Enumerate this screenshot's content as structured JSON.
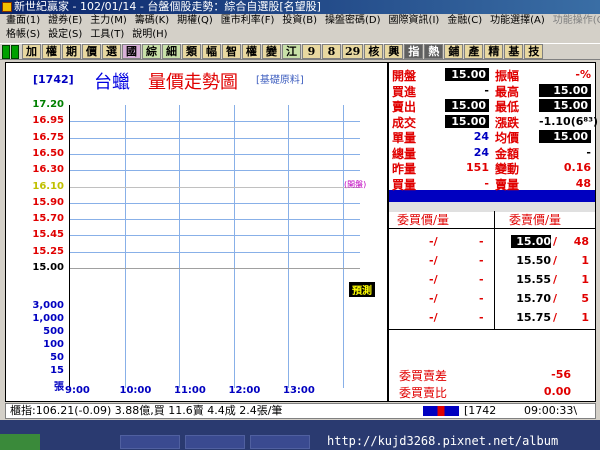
{
  "window": {
    "title": "新世紀贏家 - 102/01/14 - 台盤個股走勢：綜合自選股[名望股]"
  },
  "menu": {
    "row1": [
      "畫面(1)",
      "證券(E)",
      "主力(M)",
      "籌碼(K)",
      "期權(Q)",
      "匯市利率(F)",
      "投資(B)",
      "操盤密碼(D)",
      "國際資訊(I)",
      "金融(C)",
      "功能選擇(A)",
      "功能操作(O)"
    ],
    "row2": [
      "格帳(S)",
      "設定(S)",
      "工具(T)",
      "說明(H)"
    ]
  },
  "toolbar": {
    "buttons": [
      "加",
      "權",
      "期",
      "價",
      "選",
      "國",
      "綜",
      "細",
      "類",
      "幅",
      "智",
      "權",
      "變",
      "江",
      "9",
      "8",
      "29",
      "核",
      "興",
      "指",
      "熱",
      "鋪",
      "產",
      "精",
      "基",
      "技"
    ]
  },
  "chart": {
    "code": "[1742]",
    "stock_name": "台蠟",
    "title": "量價走勢圖",
    "category": "[基礎原料]",
    "ref_note": "(開盤)",
    "open_label": "預測"
  },
  "chart_data": {
    "type": "line",
    "title": "量價走勢圖",
    "price_ticks": [
      "17.20",
      "16.95",
      "16.75",
      "16.50",
      "16.30",
      "16.10",
      "15.90",
      "15.70",
      "15.45",
      "15.25",
      "15.00"
    ],
    "volume_ticks": [
      "3,000",
      "1,000",
      "500",
      "100",
      "50",
      "15",
      "張"
    ],
    "x_ticks": [
      "9:00",
      "10:00",
      "11:00",
      "12:00",
      "13:00"
    ],
    "reference_price": 16.1,
    "ylim": [
      15.0,
      17.2
    ],
    "series": []
  },
  "quote": {
    "rows": [
      {
        "l1": "開盤",
        "v1": "15.00",
        "l2": "振幅",
        "v2": "-%"
      },
      {
        "l1": "買進",
        "v1": "-",
        "l2": "最高",
        "v2": "15.00"
      },
      {
        "l1": "賣出",
        "v1": "15.00",
        "l2": "最低",
        "v2": "15.00"
      },
      {
        "l1": "成交",
        "v1": "15.00",
        "l2": "漲跌",
        "v2": "-1.10(6⁸³)"
      },
      {
        "l1": "單量",
        "v1": "24",
        "l2": "均價",
        "v2": "15.00"
      },
      {
        "l1": "總量",
        "v1": "24",
        "l2": "金額",
        "v2": "-"
      },
      {
        "l1": "昨量",
        "v1": "151",
        "l2": "變動",
        "v2": "0.16"
      },
      {
        "l1": "買量",
        "v1": "-",
        "l2": "賣量",
        "v2": "48"
      }
    ],
    "bid_header": "委買價/量",
    "ask_header": "委賣價/量",
    "bids": [
      {
        "p": "-/",
        "v": "-"
      },
      {
        "p": "-/",
        "v": "-"
      },
      {
        "p": "-/",
        "v": "-"
      },
      {
        "p": "-/",
        "v": "-"
      },
      {
        "p": "-/",
        "v": "-"
      }
    ],
    "asks": [
      {
        "p": "15.00",
        "v": "48"
      },
      {
        "p": "15.50",
        "v": "1"
      },
      {
        "p": "15.55",
        "v": "1"
      },
      {
        "p": "15.70",
        "v": "5"
      },
      {
        "p": "15.75",
        "v": "1"
      }
    ],
    "spread_label": "委買賣差",
    "spread": "-56",
    "ratio_label": "委買賣比",
    "ratio": "0.00"
  },
  "status": {
    "text": "櫃指:106.21(-0.09) 3.88億,買 11.6賣 4.4成 2.4張/筆",
    "code": "[1742",
    "time": "09:00:33\\"
  },
  "taskbar": {
    "url": "http://kujd3268.pixnet.net/album"
  }
}
